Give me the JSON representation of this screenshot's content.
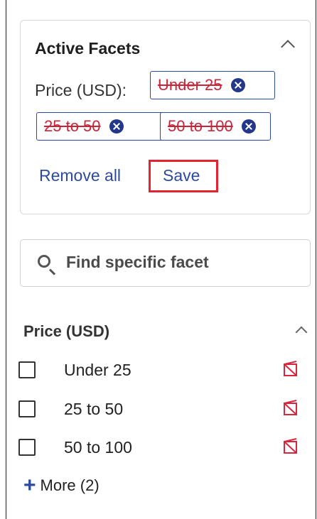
{
  "active_facets": {
    "title": "Active Facets",
    "price_label": "Price (USD):",
    "chips": [
      "Under 25",
      "25 to 50",
      "50 to 100"
    ],
    "remove_all": "Remove all",
    "save": "Save"
  },
  "search": {
    "placeholder": "Find specific facet"
  },
  "price_section": {
    "title": "Price (USD)",
    "options": [
      "Under 25",
      "25 to 50",
      "50 to 100"
    ],
    "more": "More (2)"
  },
  "colors": {
    "accent": "#2c4a9e",
    "chip_text": "#c7263a",
    "highlight": "#e3232f"
  }
}
